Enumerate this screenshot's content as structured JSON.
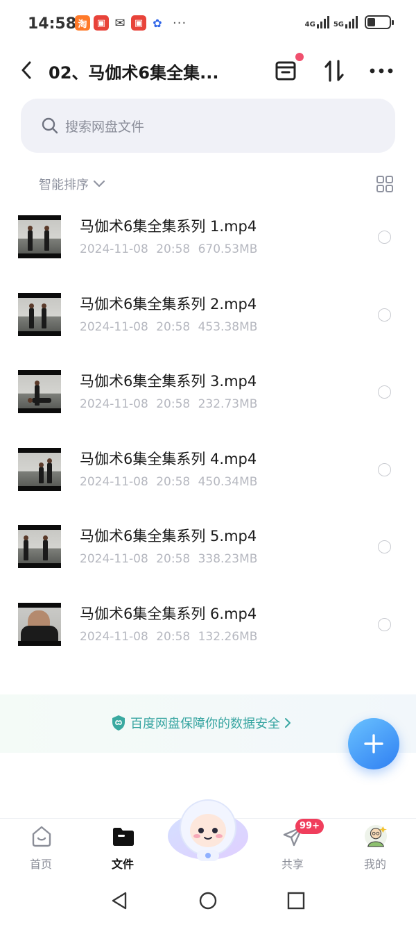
{
  "status_bar": {
    "time": "14:58",
    "notification_icons": [
      "taobao-icon",
      "app-red-icon",
      "wechat-icon",
      "app-red-icon",
      "baidu-paw-icon"
    ],
    "more": "···",
    "network_1": "4G",
    "network_2": "5G",
    "battery_level": 0.35
  },
  "header": {
    "title": "02、马伽术6集全集...",
    "has_notification_dot": true
  },
  "search": {
    "placeholder": "搜索网盘文件"
  },
  "sort": {
    "label": "智能排序"
  },
  "files": [
    {
      "name": "马伽术6集全集系列 1.mp4",
      "date": "2024-11-08",
      "time": "20:58",
      "size": "670.53MB"
    },
    {
      "name": "马伽术6集全集系列 2.mp4",
      "date": "2024-11-08",
      "time": "20:58",
      "size": "453.38MB"
    },
    {
      "name": "马伽术6集全集系列 3.mp4",
      "date": "2024-11-08",
      "time": "20:58",
      "size": "232.73MB"
    },
    {
      "name": "马伽术6集全集系列 4.mp4",
      "date": "2024-11-08",
      "time": "20:58",
      "size": "450.34MB"
    },
    {
      "name": "马伽术6集全集系列 5.mp4",
      "date": "2024-11-08",
      "time": "20:58",
      "size": "338.23MB"
    },
    {
      "name": "马伽术6集全集系列 6.mp4",
      "date": "2024-11-08",
      "time": "20:58",
      "size": "132.26MB"
    }
  ],
  "security_banner": {
    "text": "百度网盘保障你的数据安全"
  },
  "bottom_nav": {
    "home": "首页",
    "files": "文件",
    "share": "共享",
    "share_badge": "99+",
    "mine": "我的"
  },
  "colors": {
    "accent": "#2f7ff2",
    "security_text": "#37a5a1",
    "badge": "#f03e5c"
  }
}
